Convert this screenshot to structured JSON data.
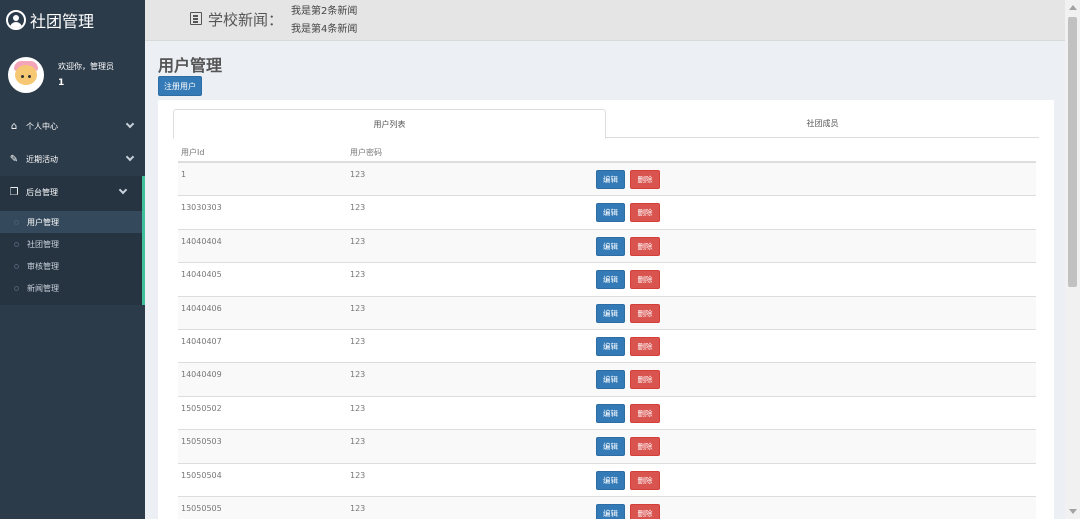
{
  "brand": {
    "title": "社团管理",
    "icon": "user-circle-icon"
  },
  "user": {
    "welcome": "欢迎你，管理员",
    "name": "1"
  },
  "menu": {
    "items": [
      {
        "label": "个人中心",
        "icon": "home-icon"
      },
      {
        "label": "近期活动",
        "icon": "edit-icon"
      },
      {
        "label": "后台管理",
        "icon": "copy-icon"
      }
    ],
    "submenu": [
      {
        "label": "用户管理"
      },
      {
        "label": "社团管理"
      },
      {
        "label": "审核管理"
      },
      {
        "label": "新闻管理"
      }
    ]
  },
  "topbar": {
    "news_label": "学校新闻：",
    "news": [
      "我是第2条新闻",
      "我是第4条新闻"
    ]
  },
  "main": {
    "title": "用户管理",
    "register_label": "注册用户",
    "tabs": [
      {
        "label": "用户列表"
      },
      {
        "label": "社团成员"
      }
    ],
    "table": {
      "headers": {
        "id": "用户Id",
        "password": "用户密码"
      },
      "edit_label": "编辑",
      "delete_label": "删除",
      "rows": [
        {
          "id": "1",
          "password": "123"
        },
        {
          "id": "13030303",
          "password": "123"
        },
        {
          "id": "14040404",
          "password": "123"
        },
        {
          "id": "14040405",
          "password": "123"
        },
        {
          "id": "14040406",
          "password": "123"
        },
        {
          "id": "14040407",
          "password": "123"
        },
        {
          "id": "14040409",
          "password": "123"
        },
        {
          "id": "15050502",
          "password": "123"
        },
        {
          "id": "15050503",
          "password": "123"
        },
        {
          "id": "15050504",
          "password": "123"
        },
        {
          "id": "15050505",
          "password": "123"
        }
      ]
    }
  },
  "colors": {
    "sidebar": "#2c3b4a",
    "accent": "#3fbf9a",
    "primary": "#337ab7",
    "danger": "#d9534f"
  }
}
